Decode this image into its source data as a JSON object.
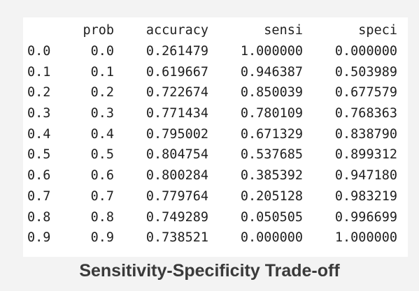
{
  "table": {
    "columns": [
      "",
      "prob",
      "accuracy",
      "sensi",
      "speci"
    ],
    "rows": [
      [
        "0.0",
        "0.0",
        "0.261479",
        "1.000000",
        "0.000000"
      ],
      [
        "0.1",
        "0.1",
        "0.619667",
        "0.946387",
        "0.503989"
      ],
      [
        "0.2",
        "0.2",
        "0.722674",
        "0.850039",
        "0.677579"
      ],
      [
        "0.3",
        "0.3",
        "0.771434",
        "0.780109",
        "0.768363"
      ],
      [
        "0.4",
        "0.4",
        "0.795002",
        "0.671329",
        "0.838790"
      ],
      [
        "0.5",
        "0.5",
        "0.804754",
        "0.537685",
        "0.899312"
      ],
      [
        "0.6",
        "0.6",
        "0.800284",
        "0.385392",
        "0.947180"
      ],
      [
        "0.7",
        "0.7",
        "0.779764",
        "0.205128",
        "0.983219"
      ],
      [
        "0.8",
        "0.8",
        "0.749289",
        "0.050505",
        "0.996699"
      ],
      [
        "0.9",
        "0.9",
        "0.738521",
        "0.000000",
        "1.000000"
      ]
    ]
  },
  "caption": "Sensitivity-Specificity Trade-off"
}
